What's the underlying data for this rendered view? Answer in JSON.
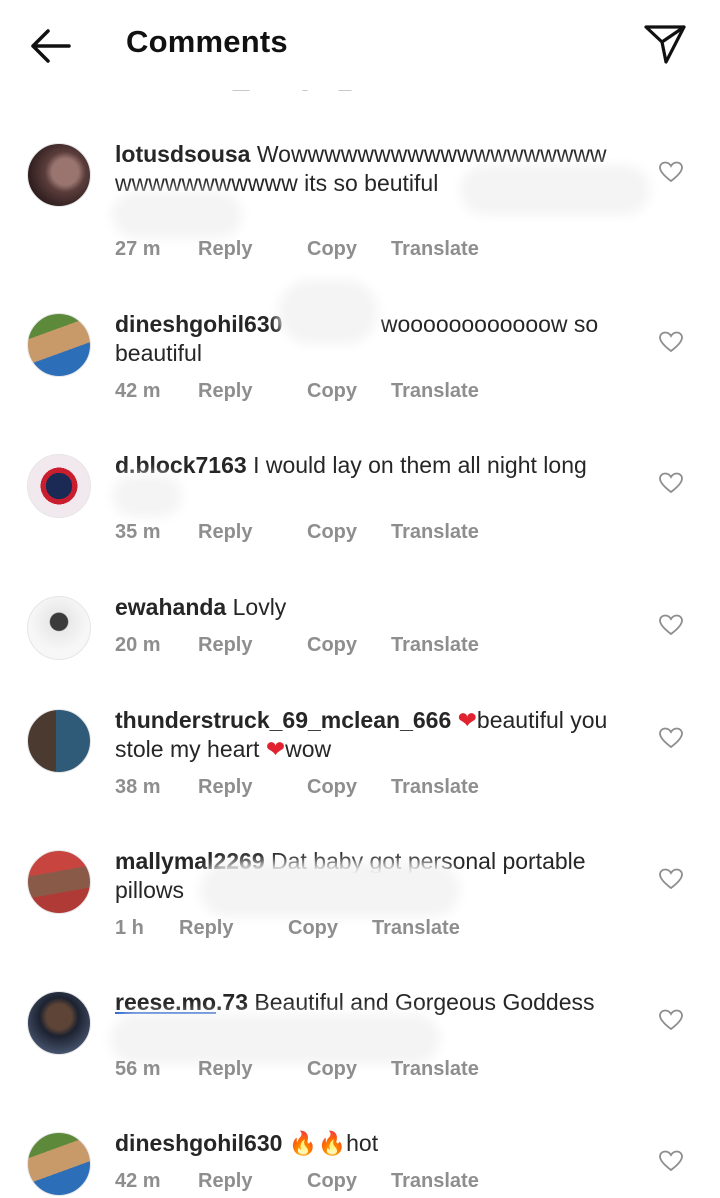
{
  "header": {
    "title": "Comments",
    "back_icon": "arrow-left-icon",
    "share_icon": "paper-plane-icon"
  },
  "actions": {
    "reply": "Reply",
    "copy": "Copy",
    "translate": "Translate"
  },
  "comments": [
    {
      "username": "lotusdsousa",
      "line1": "Wowwwwwwwwwwww",
      "line1b": "wwwwwww",
      "line2": "wwwwwwwwwww its so beutiful",
      "time": "27 m"
    },
    {
      "username": "dineshgohil630",
      "line1": "woooooooooooow so",
      "line2": "beautiful",
      "time": "42 m"
    },
    {
      "username": "d.block7163",
      "line1": " I would lay on them all night long",
      "time": "35 m"
    },
    {
      "username": "ewahanda",
      "line1": " Lovly",
      "time": "20 m"
    },
    {
      "username": "thunderstruck_69_mclean_666",
      "heart1": "❤",
      "line1": "beautiful you",
      "line2": "stole my heart ",
      "heart2": "❤",
      "line2b": "wow",
      "time": "38 m"
    },
    {
      "username": "mallymal2269",
      "line1": " Dat baby got personal portable",
      "line2": "pillows",
      "time": "1 h"
    },
    {
      "username_link": "reese.mo",
      "username_rest": ".73",
      "line1": " Beautiful and Gorgeous Goddess",
      "time": "56 m"
    },
    {
      "username": "dineshgohil630",
      "emoji": "🔥",
      "line1": "hot",
      "time": "42 m"
    }
  ],
  "colors": {
    "text": "#262626",
    "secondary": "#8e8e8e",
    "heart_red": "#e0232e",
    "link": "#1f5ec8"
  }
}
